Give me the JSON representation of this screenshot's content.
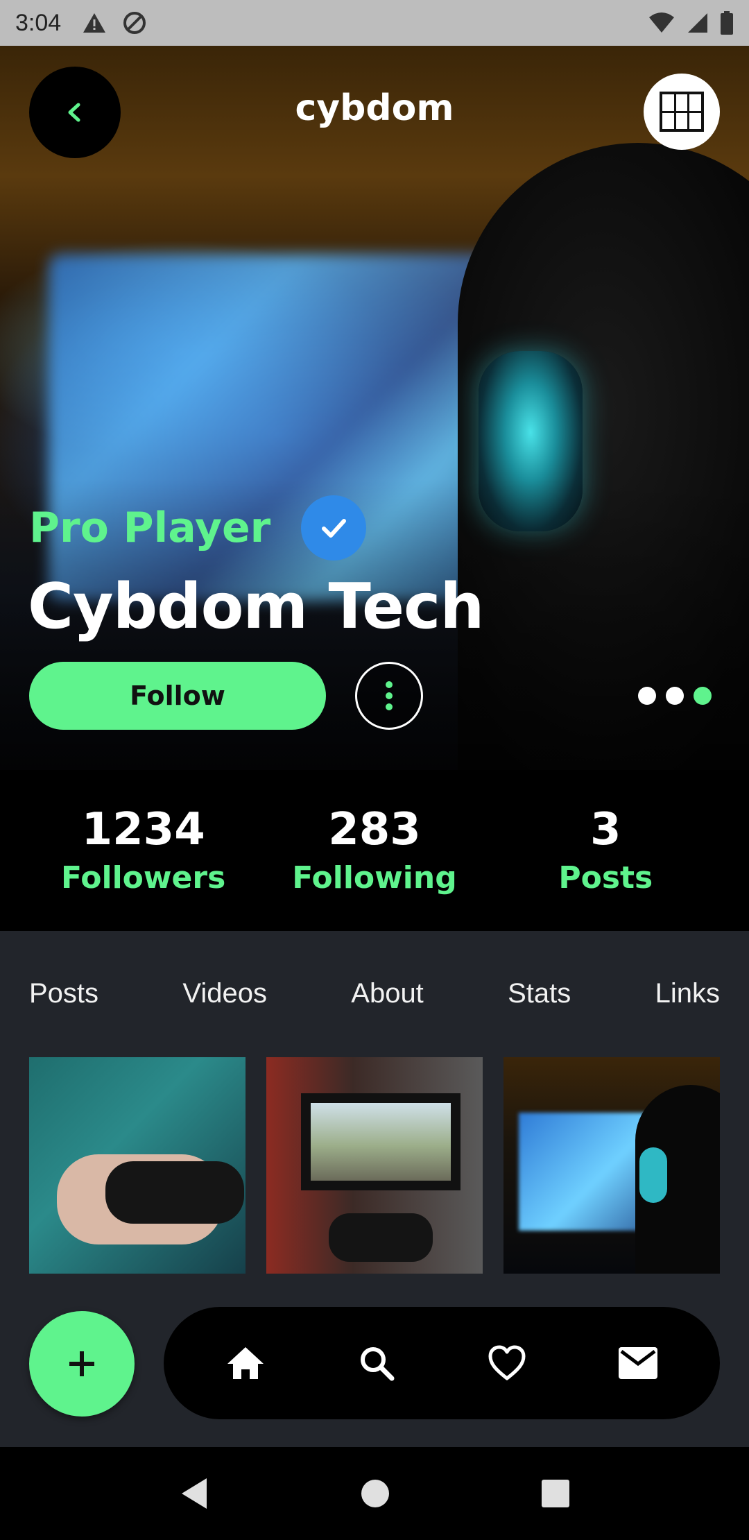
{
  "status_bar": {
    "time": "3:04",
    "icons": [
      "warning-icon",
      "sync-disabled-icon",
      "wifi-icon",
      "signal-icon",
      "battery-icon"
    ]
  },
  "header": {
    "title": "cybdom",
    "back_icon": "chevron-left-icon",
    "avatar_alt": "CYBDOM freelance developer logo"
  },
  "profile": {
    "badge_label": "Pro Player",
    "name": "Cybdom Tech",
    "follow_label": "Follow",
    "carousel": {
      "count": 3,
      "active_index": 2
    }
  },
  "stats": [
    {
      "value": "1234",
      "label": "Followers"
    },
    {
      "value": "283",
      "label": "Following"
    },
    {
      "value": "3",
      "label": "Posts"
    }
  ],
  "tabs": [
    "Posts",
    "Videos",
    "About",
    "Stats",
    "Links"
  ],
  "posts": [
    {
      "name": "post-controller-hands"
    },
    {
      "name": "post-racing-game-tv"
    },
    {
      "name": "post-gamer-headset"
    }
  ],
  "nav": {
    "fab_icon": "plus-icon",
    "items": [
      "home-icon",
      "search-icon",
      "heart-icon",
      "mail-icon"
    ]
  },
  "system_nav": [
    "back-triangle-icon",
    "home-circle-icon",
    "recents-square-icon"
  ],
  "colors": {
    "accent": "#5ff38d",
    "verified": "#2f8ae8",
    "content_bg": "#22252b",
    "status_bar_bg": "#bdbdbd"
  }
}
